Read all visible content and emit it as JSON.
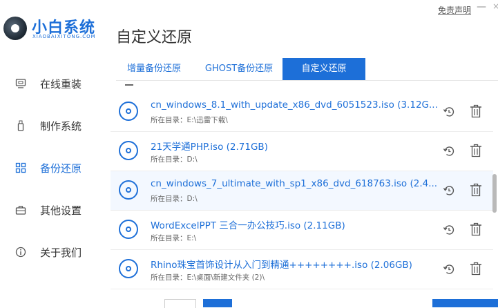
{
  "header": {
    "logo_title": "小白系统",
    "logo_subtitle": "XIAOBAIXITONG.COM",
    "page_title": "自定义还原",
    "disclaimer": "免责声明",
    "minimize_glyph": "—",
    "close_glyph": "×"
  },
  "sidebar": {
    "items": [
      {
        "label": "在线重装",
        "icon": "monitor-icon"
      },
      {
        "label": "制作系统",
        "icon": "usb-drive-icon"
      },
      {
        "label": "备份还原",
        "icon": "backup-grid-icon",
        "active": true
      },
      {
        "label": "其他设置",
        "icon": "briefcase-icon"
      },
      {
        "label": "关于我们",
        "icon": "info-icon"
      }
    ]
  },
  "tabs": [
    {
      "label": "增量备份还原"
    },
    {
      "label": "GHOST备份还原"
    },
    {
      "label": "自定义还原",
      "active": true
    }
  ],
  "list": {
    "items": [
      {
        "name": "cn_windows_8.1_with_update_x86_dvd_6051523.iso (3.12G...",
        "dir": "所在目录：E:\\迅雷下载\\"
      },
      {
        "name": "21天学通PHP.iso (2.71GB)",
        "dir": "所在目录：D:\\"
      },
      {
        "name": "cn_windows_7_ultimate_with_sp1_x86_dvd_618763.iso (2.4...",
        "dir": "所在目录：D:\\",
        "highlight": true
      },
      {
        "name": "WordExcelPPT 三合一办公技巧.iso (2.11GB)",
        "dir": "所在目录：E:\\"
      },
      {
        "name": "Rhino珠宝首饰设计从入门到精通++++++++.iso (2.06GB)",
        "dir": "所在目录：E:\\桌面\\新建文件夹 (2)\\"
      }
    ]
  },
  "colors": {
    "accent": "#1d6fd8",
    "row_highlight": "#f3f8ff"
  }
}
